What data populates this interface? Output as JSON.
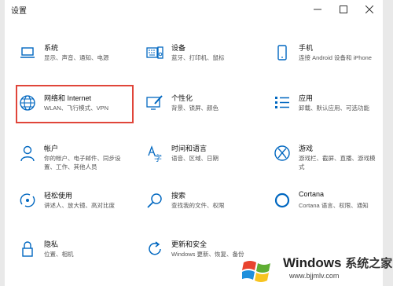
{
  "window": {
    "title": "设置",
    "controls": [
      "minimize-icon",
      "maximize-icon",
      "close-icon"
    ]
  },
  "tiles": [
    {
      "name": "系统",
      "desc": "显示、声音、通知、电源",
      "icon": "laptop-icon"
    },
    {
      "name": "设备",
      "desc": "蓝牙、打印机、鼠标",
      "icon": "keyboard-speaker-icon"
    },
    {
      "name": "手机",
      "desc": "连接 Android 设备和 iPhone",
      "icon": "phone-icon"
    },
    {
      "name": "网络和 Internet",
      "desc": "WLAN、飞行模式、VPN",
      "icon": "globe-icon"
    },
    {
      "name": "个性化",
      "desc": "背景、锁屏、颜色",
      "icon": "paint-icon"
    },
    {
      "name": "应用",
      "desc": "卸载、默认应用、可选功能",
      "icon": "apps-list-icon"
    },
    {
      "name": "帐户",
      "desc": "你的帐户、电子邮件、同步设置、工作、其他人员",
      "desc_lines": [
        "你的帐户、电子邮件、同步设",
        "置、工作、其他人员"
      ],
      "icon": "person-icon"
    },
    {
      "name": "时间和语言",
      "desc": "语音、区域、日期",
      "icon": "time-language-icon"
    },
    {
      "name": "游戏",
      "desc": "游戏栏、截屏、直播、游戏模式",
      "desc_lines": [
        "游戏栏、截屏、直播、游戏模",
        "式"
      ],
      "icon": "xbox-icon"
    },
    {
      "name": "轻松使用",
      "desc": "讲述人、放大镜、高对比度",
      "icon": "ease-access-icon"
    },
    {
      "name": "搜索",
      "desc": "查找我的文件、权限",
      "icon": "search-icon"
    },
    {
      "name": "Cortana",
      "desc": "Cortana 语言、权限、通知",
      "icon": "cortana-icon"
    },
    {
      "name": "隐私",
      "desc": "位置、相机",
      "icon": "lock-icon"
    },
    {
      "name": "更新和安全",
      "desc": "Windows 更新、恢复、备份",
      "icon": "update-icon"
    }
  ],
  "highlighted_tile": "网络和 Internet",
  "watermark": {
    "brand": "Windows",
    "brand_zh": "系统之家",
    "url": "www.bjjmlv.com"
  },
  "colors": {
    "accent": "#0067c0",
    "highlight": "#e0453a"
  }
}
